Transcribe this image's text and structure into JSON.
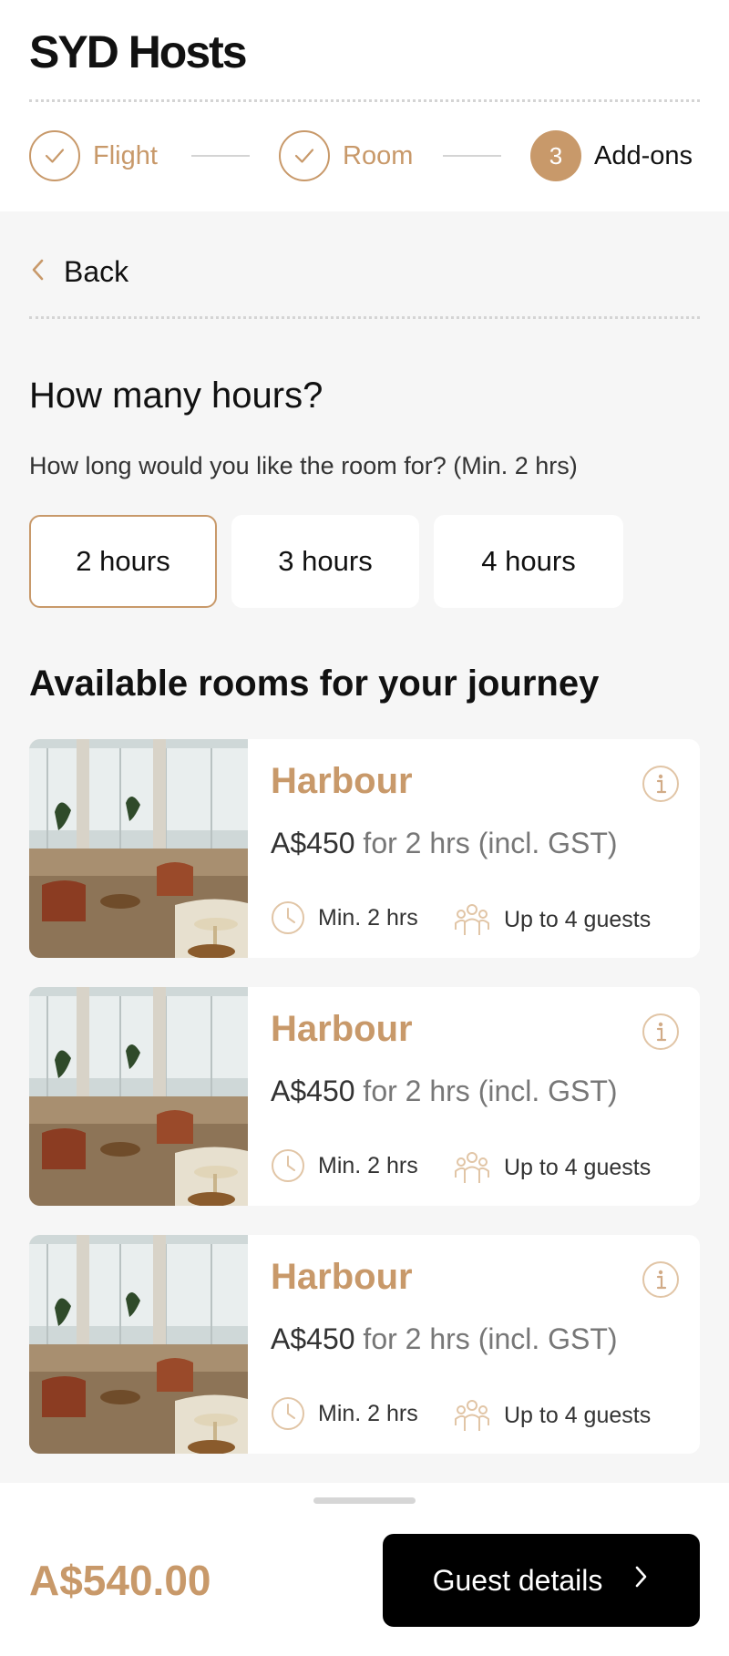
{
  "header": {
    "brand": "SYD Hosts"
  },
  "stepper": {
    "steps": [
      {
        "label": "Flight",
        "state": "done"
      },
      {
        "label": "Room",
        "state": "done"
      },
      {
        "label": "Add-ons",
        "state": "active",
        "number": "3"
      }
    ]
  },
  "nav": {
    "back_label": "Back"
  },
  "hours": {
    "title": "How many hours?",
    "subtitle": "How long would you like the room for? (Min. 2 hrs)",
    "options": [
      "2 hours",
      "3 hours",
      "4 hours"
    ],
    "selected": "2 hours"
  },
  "rooms": {
    "title": "Available rooms for your journey",
    "items": [
      {
        "name": "Harbour",
        "price": "A$450",
        "price_suffix": " for 2 hrs (incl. GST)",
        "min": "Min. 2 hrs",
        "guests": "Up to 4 guests"
      },
      {
        "name": "Harbour",
        "price": "A$450",
        "price_suffix": " for 2 hrs (incl. GST)",
        "min": "Min. 2 hrs",
        "guests": "Up to 4 guests"
      },
      {
        "name": "Harbour",
        "price": "A$450",
        "price_suffix": " for 2 hrs (incl. GST)",
        "min": "Min. 2 hrs",
        "guests": "Up to 4 guests"
      }
    ]
  },
  "footer": {
    "total": "A$540.00",
    "cta_label": "Guest details"
  },
  "colors": {
    "accent": "#c8996a",
    "background": "#f6f6f6",
    "cta": "#000000"
  },
  "icons": [
    "check-icon",
    "chevron-left-icon",
    "info-icon",
    "clock-icon",
    "guests-icon",
    "chevron-right-icon"
  ]
}
